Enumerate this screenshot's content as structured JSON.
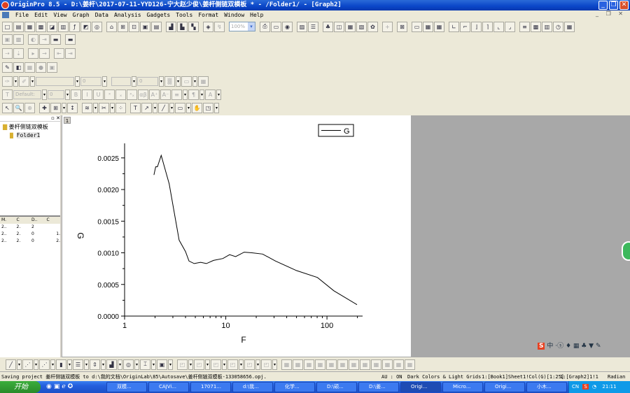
{
  "window": {
    "title": "OriginPro 8.5 - D:\\姜杆\\2017-07-11-YYD126-宁大赵少俊\\姜杆侧链双模板 * - /Folder1/ - [Graph2]"
  },
  "menu": [
    "File",
    "Edit",
    "View",
    "Graph",
    "Data",
    "Analysis",
    "Gadgets",
    "Tools",
    "Format",
    "Window",
    "Help"
  ],
  "toolbar": {
    "zoom_value": "100%",
    "font_name": "Default:",
    "font_size": "0",
    "line_width": "0",
    "border_width": "0"
  },
  "explorer": {
    "root": "姜杆侧链双模板",
    "folder": "Folder1",
    "columns": [
      "M.",
      "C",
      "D..",
      "C"
    ],
    "rows": [
      [
        "2..",
        "2.",
        "2",
        ""
      ],
      [
        "2..",
        "2.",
        "0",
        "1."
      ],
      [
        "2..",
        "2.",
        "0",
        "2."
      ]
    ]
  },
  "graph": {
    "layer_label": "1"
  },
  "chart_data": {
    "type": "line",
    "title": "",
    "xlabel": "F",
    "ylabel": "G",
    "xscale": "log",
    "xlim": [
      1,
      225
    ],
    "ylim": [
      0,
      0.00273
    ],
    "xticks": [
      "1",
      "10",
      "100"
    ],
    "yticks": [
      "0.0000",
      "0.0005",
      "0.0010",
      "0.0015",
      "0.0020",
      "0.0025"
    ],
    "legend": {
      "entries": [
        "G"
      ],
      "placement": "top-right"
    },
    "series": [
      {
        "name": "G",
        "x": [
          1.95,
          2.03,
          2.11,
          2.3,
          2.76,
          3.15,
          3.46,
          4.0,
          4.33,
          4.87,
          5.64,
          6.44,
          7.56,
          9.36,
          10.9,
          12.5,
          15.2,
          18.1,
          23.1,
          31,
          49.9,
          80.5,
          116.9,
          198
        ],
        "y": [
          0.00223,
          0.00236,
          0.00236,
          0.00254,
          0.00209,
          0.00157,
          0.0012,
          0.00102,
          0.00087,
          0.00083,
          0.00085,
          0.00083,
          0.00088,
          0.00091,
          0.00097,
          0.00094,
          0.00101,
          0.001,
          0.00098,
          0.00087,
          0.00072,
          0.00061,
          0.0004,
          0.00018
        ]
      }
    ]
  },
  "status": {
    "message": "Saving project 姜杆侧链双模板 to d:\\我的文档\\OriginLab\\85\\Autosave\\姜杆侧链双模板-133058656.opj.",
    "au": "AU : ON",
    "theme": "Dark Colors & Light Grids",
    "cell": "1:[Book1]Sheet1!Col(G)[1:25]",
    "graph": "1:[Graph2]1!1",
    "angle": "Radian"
  },
  "taskbar": {
    "start": "开始",
    "tasks": [
      "双模...",
      "CAJVi...",
      "17071...",
      "d:\\我...",
      "化学...",
      "D:\\硕...",
      "D:\\姜...",
      "Origi...",
      "Micro...",
      "Origi...",
      "小木..."
    ],
    "lang": "CN",
    "time": "21:11"
  },
  "ime": {
    "label": "中"
  }
}
